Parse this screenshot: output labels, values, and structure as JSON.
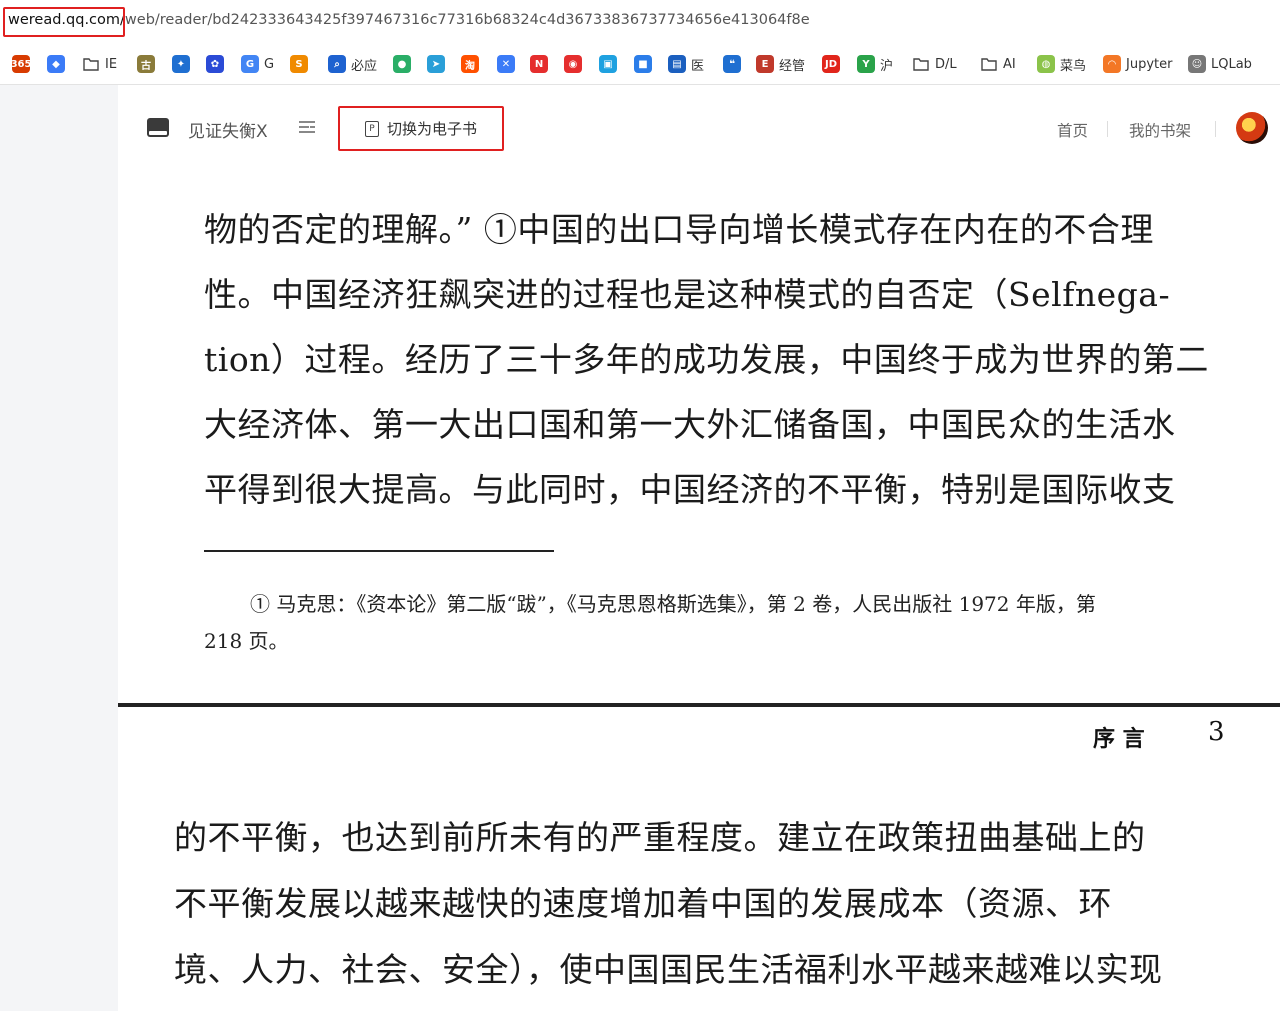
{
  "browser": {
    "address_host": "weread.qq.com/",
    "address_path": "web/reader/bd242333643425f397467316c77316b68324c4d36733836737734656e413064f8e"
  },
  "bookmarks": [
    {
      "name": "office365-bookmark",
      "icon": "365",
      "label": "",
      "color": "#d83b01"
    },
    {
      "name": "bookmark-app",
      "icon": "◆",
      "label": "",
      "color": "#3b7bf7"
    },
    {
      "name": "folder-ie",
      "icon": "folder",
      "label": "IE",
      "color": ""
    },
    {
      "name": "bookmark-gu",
      "icon": "古",
      "label": "",
      "color": "#8a7b3a"
    },
    {
      "name": "bookmark-bird",
      "icon": "✦",
      "label": "",
      "color": "#1f6fd1"
    },
    {
      "name": "bookmark-baidu",
      "icon": "✿",
      "label": "",
      "color": "#2b4bd6"
    },
    {
      "name": "bookmark-google",
      "icon": "G",
      "label": "G",
      "color": "#4285f4"
    },
    {
      "name": "bookmark-sogou",
      "icon": "S",
      "label": "",
      "color": "#f08a00"
    },
    {
      "name": "bookmark-bing",
      "icon": "⌕",
      "label": "必应",
      "color": "#1e62d0"
    },
    {
      "name": "bookmark-wechat",
      "icon": "●",
      "label": "",
      "color": "#2aae67"
    },
    {
      "name": "bookmark-plane",
      "icon": "➤",
      "label": "",
      "color": "#2a9fd8"
    },
    {
      "name": "bookmark-taobao",
      "icon": "淘",
      "label": "",
      "color": "#ff5000"
    },
    {
      "name": "bookmark-circle",
      "icon": "✕",
      "label": "",
      "color": "#3b7bf7"
    },
    {
      "name": "bookmark-red",
      "icon": "N",
      "label": "",
      "color": "#e52e2e"
    },
    {
      "name": "bookmark-music",
      "icon": "◉",
      "label": "",
      "color": "#e52e2e"
    },
    {
      "name": "bookmark-bili",
      "icon": "▣",
      "label": "",
      "color": "#1fa1e0"
    },
    {
      "name": "bookmark-blue",
      "icon": "■",
      "label": "",
      "color": "#2b7de9"
    },
    {
      "name": "bookmark-med",
      "icon": "▤",
      "label": "医",
      "color": "#1b5fbf"
    },
    {
      "name": "bookmark-quote",
      "icon": "❝",
      "label": "",
      "color": "#1f6fd1"
    },
    {
      "name": "bookmark-econ",
      "icon": "E",
      "label": "经管",
      "color": "#c0392b"
    },
    {
      "name": "bookmark-jd",
      "icon": "JD",
      "label": "",
      "color": "#e1251b"
    },
    {
      "name": "bookmark-hu",
      "icon": "Y",
      "label": "沪",
      "color": "#2aa34a"
    },
    {
      "name": "folder-dl",
      "icon": "folder",
      "label": "D/L",
      "color": ""
    },
    {
      "name": "folder-ai",
      "icon": "folder",
      "label": "AI",
      "color": ""
    },
    {
      "name": "bookmark-runoob",
      "icon": "◍",
      "label": "菜鸟",
      "color": "#8bc34a"
    },
    {
      "name": "bookmark-jupyter",
      "icon": "◠",
      "label": "Jupyter",
      "color": "#f37726"
    },
    {
      "name": "bookmark-lqlab",
      "icon": "☺",
      "label": "LQLab",
      "color": "#777777"
    }
  ],
  "reader": {
    "book_title": "见证失衡X",
    "switch_label": "切换为电子书",
    "switch_icon": "P",
    "nav_home": "首页",
    "nav_shelf": "我的书架"
  },
  "page1": {
    "lines": [
      "物的否定的理解。” ①中国的出口导向增长模式存在内在的不合理",
      "性。中国经济狂飙突进的过程也是这种模式的自否定（Selfnega-",
      "tion）过程。经历了三十多年的成功发展，中国终于成为世界的第二",
      "大经济体、第一大出口国和第一大外汇储备国，中国民众的生活水",
      "平得到很大提高。与此同时，中国经济的不平衡，特别是国际收支"
    ],
    "footnote_1": "①  马克思：《资本论》第二版“跋”，《马克思恩格斯选集》，第 2 卷，人民出版社 1972 年版，第",
    "footnote_2": "218 页。"
  },
  "page2": {
    "header": "序    言",
    "page_number": "3",
    "lines": [
      "的不平衡，也达到前所未有的严重程度。建立在政策扭曲基础上的",
      "不平衡发展以越来越快的速度增加着中国的发展成本（资源、环",
      "境、人力、社会、安全），使中国国民生活福利水平越来越难以实现"
    ]
  }
}
